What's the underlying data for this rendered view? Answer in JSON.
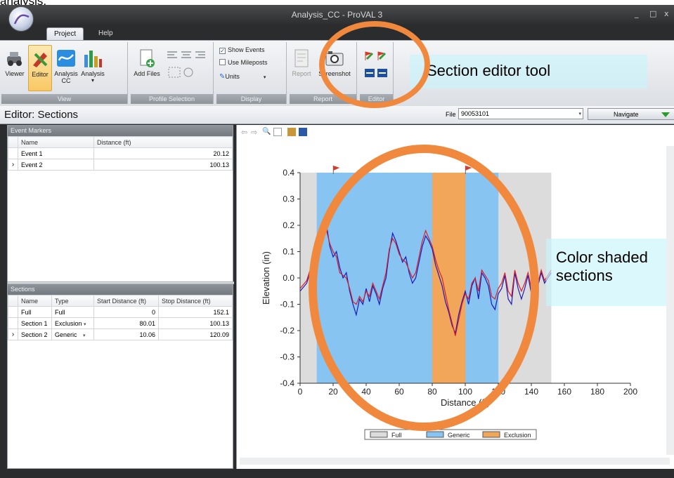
{
  "caption_top": "analysis.",
  "window": {
    "title": "Analysis_CC - ProVAL 3",
    "controls": [
      "_",
      "□",
      "x"
    ]
  },
  "ribbon_tabs": [
    {
      "label": "Project",
      "active": true
    },
    {
      "label": "Help",
      "active": false
    }
  ],
  "ribbon": {
    "view_group": {
      "label": "View",
      "buttons": [
        {
          "label": "Viewer",
          "icon": "viewer-icon"
        },
        {
          "label": "Editor",
          "icon": "editor-icon",
          "active": true
        },
        {
          "label": "Analysis CC",
          "icon": "analysis-cc-icon"
        },
        {
          "label": "Analysis",
          "icon": "analysis-bars-icon"
        }
      ]
    },
    "profile_group": {
      "label": "Profile Selection",
      "add_files_label": "Add Files"
    },
    "display_group": {
      "label": "Display",
      "show_events_label": "Show Events",
      "show_events_checked": true,
      "use_mileposts_label": "Use Mileposts",
      "use_mileposts_checked": false,
      "units_label": "Units"
    },
    "report_group": {
      "label": "Report",
      "report_label": "Report",
      "screenshot_label": "Screenshot"
    },
    "editor_group": {
      "label": "Editor"
    }
  },
  "callouts": {
    "section_editor": "Section editor tool",
    "color_shaded_line1": "Color shaded",
    "color_shaded_line2": "sections",
    "ring_color": "#f0893d"
  },
  "editor_bar": {
    "title": "Editor: Sections",
    "file_label": "File",
    "file_value": "90053101",
    "navigate_label": "Navigate"
  },
  "event_markers": {
    "header": "Event Markers",
    "columns": [
      "Name",
      "Distance (ft)"
    ],
    "rows": [
      {
        "name": "Event 1",
        "distance": "20.12",
        "selected": false
      },
      {
        "name": "Event 2",
        "distance": "100.13",
        "selected": true
      }
    ]
  },
  "sections": {
    "header": "Sections",
    "columns": [
      "Name",
      "Type",
      "Start Distance (ft)",
      "Stop Distance (ft)"
    ],
    "rows": [
      {
        "name": "Full",
        "type": "Full",
        "start": "0",
        "stop": "152.1",
        "selected": false,
        "dropdown": false
      },
      {
        "name": "Section 1",
        "type": "Exclusion",
        "start": "80.01",
        "stop": "100.13",
        "selected": false,
        "dropdown": true
      },
      {
        "name": "Section 2",
        "type": "Generic",
        "start": "10.06",
        "stop": "120.09",
        "selected": true,
        "dropdown": true
      }
    ]
  },
  "chart_data": {
    "type": "line",
    "title": "",
    "xlabel": "Distance (ft)",
    "ylabel": "Elevation (in)",
    "xlim": [
      0,
      200
    ],
    "ylim": [
      -0.4,
      0.4
    ],
    "xticks": [
      0,
      20,
      40,
      60,
      80,
      100,
      120,
      140,
      160,
      180,
      200
    ],
    "yticks": [
      0.4,
      0.3,
      0.2,
      0.1,
      0.0,
      -0.1,
      -0.2,
      -0.3,
      -0.4
    ],
    "ytick_labels": [
      "0.4",
      "0.3",
      "0.2",
      "0.1",
      "0.0",
      "-0.1",
      "-0.2",
      "-0.3",
      "-0.4"
    ],
    "regions": [
      {
        "name": "Full",
        "start": 0,
        "stop": 152.1,
        "color": "#dcdcdc"
      },
      {
        "name": "Generic",
        "start": 10.06,
        "stop": 120.09,
        "color": "#88c4f2"
      },
      {
        "name": "Exclusion",
        "start": 80.01,
        "stop": 100.13,
        "color": "#f2a65a"
      }
    ],
    "event_flags": [
      20.12,
      100.13
    ],
    "series": [
      {
        "color": "#1a1ab8",
        "x": [
          0,
          4,
          6,
          8,
          10,
          12,
          14,
          16,
          18,
          20,
          22,
          24,
          26,
          28,
          30,
          32,
          34,
          36,
          38,
          40,
          42,
          44,
          46,
          48,
          50,
          52,
          54,
          56,
          58,
          60,
          62,
          64,
          66,
          68,
          70,
          72,
          74,
          76,
          78,
          80,
          82,
          84,
          86,
          88,
          90,
          92,
          94,
          96,
          98,
          100,
          102,
          104,
          106,
          108,
          110,
          112,
          114,
          116,
          118,
          120,
          122,
          124,
          126,
          128,
          130,
          132,
          134,
          136,
          138,
          140,
          142,
          144,
          146,
          148,
          150,
          152
        ],
        "values": [
          -0.05,
          -0.02,
          0.02,
          -0.04,
          0.03,
          0.12,
          0.18,
          0.2,
          0.12,
          0.08,
          0.1,
          0.04,
          0.0,
          0.02,
          -0.05,
          -0.1,
          -0.14,
          -0.08,
          -0.1,
          -0.04,
          -0.09,
          -0.03,
          -0.06,
          -0.1,
          -0.04,
          0.0,
          0.1,
          0.17,
          0.14,
          0.1,
          0.06,
          0.08,
          0.02,
          -0.02,
          0.0,
          0.06,
          0.12,
          0.16,
          0.14,
          0.11,
          0.05,
          0.01,
          -0.03,
          -0.09,
          -0.13,
          -0.18,
          -0.21,
          -0.14,
          -0.09,
          -0.05,
          -0.1,
          -0.03,
          0.0,
          -0.08,
          0.02,
          0.0,
          -0.03,
          -0.1,
          -0.12,
          -0.06,
          -0.04,
          0.01,
          -0.08,
          -0.1,
          0.02,
          -0.04,
          -0.08,
          -0.04,
          0.01,
          -0.06,
          -0.02,
          -0.03,
          0.02,
          -0.02,
          0.0,
          0.02
        ]
      },
      {
        "color": "#d4202a",
        "x": [
          0,
          4,
          6,
          8,
          10,
          12,
          14,
          16,
          18,
          20,
          22,
          24,
          26,
          28,
          30,
          32,
          34,
          36,
          38,
          40,
          42,
          44,
          46,
          48,
          50,
          52,
          54,
          56,
          58,
          60,
          62,
          64,
          66,
          68,
          70,
          72,
          74,
          76,
          78,
          80,
          82,
          84,
          86,
          88,
          90,
          92,
          94,
          96,
          98,
          100,
          102,
          104,
          106,
          108,
          110,
          112,
          114,
          116,
          118,
          120,
          122,
          124,
          126,
          128,
          130,
          132,
          134,
          136,
          138,
          140,
          142,
          144,
          146,
          148,
          150,
          152
        ],
        "values": [
          -0.04,
          -0.01,
          0.03,
          -0.02,
          0.05,
          0.13,
          0.17,
          0.18,
          0.13,
          0.1,
          0.08,
          0.02,
          0.01,
          0.0,
          -0.04,
          -0.09,
          -0.1,
          -0.07,
          -0.09,
          -0.05,
          -0.07,
          -0.02,
          -0.05,
          -0.08,
          -0.03,
          0.02,
          0.11,
          0.15,
          0.13,
          0.09,
          0.07,
          0.06,
          0.03,
          0.0,
          0.02,
          0.08,
          0.14,
          0.18,
          0.15,
          0.12,
          0.07,
          0.03,
          0.0,
          -0.06,
          -0.12,
          -0.17,
          -0.22,
          -0.16,
          -0.1,
          -0.06,
          -0.08,
          -0.02,
          0.0,
          -0.05,
          0.03,
          0.01,
          -0.01,
          -0.07,
          -0.08,
          -0.04,
          -0.02,
          0.02,
          -0.05,
          -0.07,
          0.03,
          -0.02,
          -0.05,
          -0.02,
          0.02,
          -0.04,
          -0.01,
          -0.02,
          0.03,
          -0.01,
          0.01,
          0.03
        ]
      }
    ],
    "legend": {
      "position": "bottom",
      "entries": [
        "Full",
        "Generic",
        "Exclusion"
      ]
    }
  }
}
